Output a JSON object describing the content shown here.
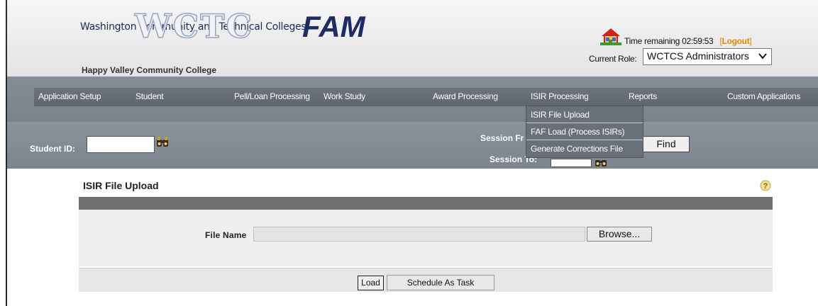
{
  "header": {
    "brand_text": "Washington Community and Technical Colleges",
    "logo_wctc": "WCTC",
    "logo_fam": "FAM",
    "college_name": "Happy Valley Community College",
    "time_remaining": "Time remaining 02:59:53",
    "bracket_open": "[",
    "logout_label": "Logout",
    "bracket_close": "]",
    "role_label": "Current Role:",
    "role_value": "WCTCS Administrators"
  },
  "nav": {
    "items": [
      {
        "label": "Application Setup"
      },
      {
        "label": "Student"
      },
      {
        "label": "Pell/Loan Processing"
      },
      {
        "label": "Work Study"
      },
      {
        "label": "Award Processing"
      },
      {
        "label": "ISIR Processing"
      },
      {
        "label": "Reports"
      },
      {
        "label": "Custom Applications"
      }
    ],
    "dropdown": [
      {
        "label": "ISIR File Upload"
      },
      {
        "label": "FAF Load (Process ISIRs)"
      },
      {
        "label": "Generate Corrections File"
      }
    ]
  },
  "search": {
    "student_id_label": "Student ID:",
    "student_id_value": "",
    "session_from_label": "Session Fr",
    "session_to_label": "Session To:",
    "find_label": "Find"
  },
  "content": {
    "title": "ISIR File Upload",
    "file_name_label": "File Name",
    "file_name_value": "",
    "browse_label": "Browse...",
    "load_label": "Load",
    "schedule_label": "Schedule As Task"
  },
  "colors": {
    "fam_blue": "#1e2b64",
    "logout_orange": "#e08a00",
    "nav_gray": "#6d747e"
  }
}
